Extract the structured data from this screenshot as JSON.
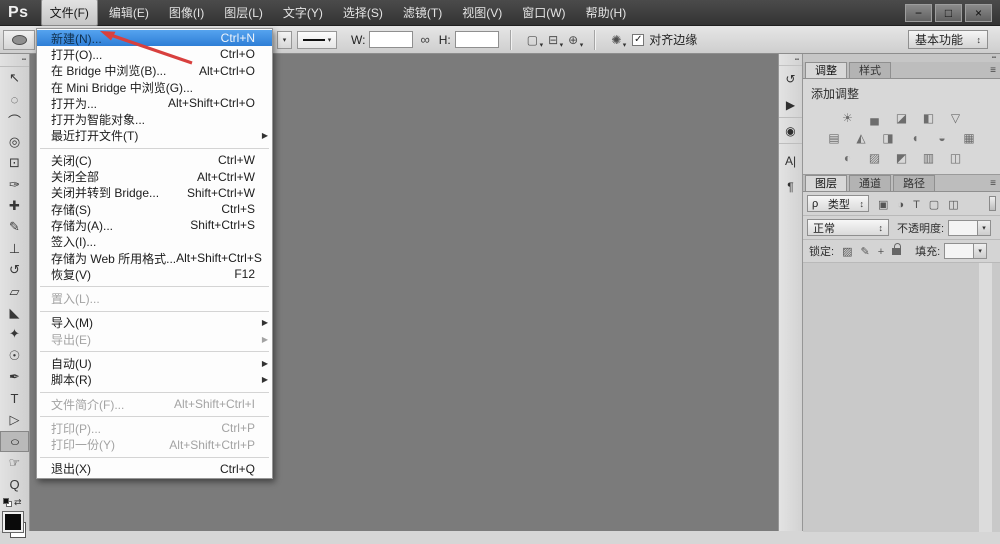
{
  "titlebar": {
    "logo": "Ps",
    "menus": [
      {
        "label": "文件(F)",
        "state": "pressed"
      },
      {
        "label": "编辑(E)"
      },
      {
        "label": "图像(I)"
      },
      {
        "label": "图层(L)"
      },
      {
        "label": "文字(Y)"
      },
      {
        "label": "选择(S)"
      },
      {
        "label": "滤镜(T)"
      },
      {
        "label": "视图(V)"
      },
      {
        "label": "窗口(W)"
      },
      {
        "label": "帮助(H)"
      }
    ],
    "window_buttons": {
      "minimize": "−",
      "maximize": "□",
      "close": "×"
    }
  },
  "file_menu": {
    "items": [
      {
        "label": "新建(N)...",
        "shortcut": "Ctrl+N",
        "state": "highlighted"
      },
      {
        "label": "打开(O)...",
        "shortcut": "Ctrl+O"
      },
      {
        "label": "在 Bridge 中浏览(B)...",
        "shortcut": "Alt+Ctrl+O"
      },
      {
        "label": "在 Mini Bridge 中浏览(G)...",
        "shortcut": ""
      },
      {
        "label": "打开为...",
        "shortcut": "Alt+Shift+Ctrl+O"
      },
      {
        "label": "打开为智能对象...",
        "shortcut": ""
      },
      {
        "label": "最近打开文件(T)",
        "shortcut": "",
        "arrow": "▶"
      },
      {
        "type": "sep"
      },
      {
        "label": "关闭(C)",
        "shortcut": "Ctrl+W"
      },
      {
        "label": "关闭全部",
        "shortcut": "Alt+Ctrl+W"
      },
      {
        "label": "关闭并转到 Bridge...",
        "shortcut": "Shift+Ctrl+W"
      },
      {
        "label": "存储(S)",
        "shortcut": "Ctrl+S"
      },
      {
        "label": "存储为(A)...",
        "shortcut": "Shift+Ctrl+S"
      },
      {
        "label": "签入(I)...",
        "shortcut": ""
      },
      {
        "label": "存储为 Web 所用格式...",
        "shortcut": "Alt+Shift+Ctrl+S"
      },
      {
        "label": "恢复(V)",
        "shortcut": "F12"
      },
      {
        "type": "sep"
      },
      {
        "label": "置入(L)...",
        "shortcut": "",
        "state": "disabled"
      },
      {
        "type": "sep"
      },
      {
        "label": "导入(M)",
        "shortcut": "",
        "arrow": "▶"
      },
      {
        "label": "导出(E)",
        "shortcut": "",
        "arrow": "▶",
        "state": "disabled"
      },
      {
        "type": "sep"
      },
      {
        "label": "自动(U)",
        "shortcut": "",
        "arrow": "▶"
      },
      {
        "label": "脚本(R)",
        "shortcut": "",
        "arrow": "▶"
      },
      {
        "type": "sep"
      },
      {
        "label": "文件简介(F)...",
        "shortcut": "Alt+Shift+Ctrl+I",
        "state": "disabled"
      },
      {
        "type": "sep"
      },
      {
        "label": "打印(P)...",
        "shortcut": "Ctrl+P",
        "state": "disabled"
      },
      {
        "label": "打印一份(Y)",
        "shortcut": "Alt+Shift+Ctrl+P",
        "state": "disabled"
      },
      {
        "type": "sep"
      },
      {
        "label": "退出(X)",
        "shortcut": "Ctrl+Q"
      }
    ]
  },
  "options_bar": {
    "w_label": "W:",
    "w_value": "",
    "h_label": "H:",
    "h_value": "",
    "link_glyph": "∞",
    "drop_glyph": "▾",
    "path_icons": [
      {
        "name": "path-operations-icon",
        "glyph": "▢"
      },
      {
        "name": "path-alignment-icon",
        "glyph": "⊟"
      },
      {
        "name": "path-arrangement-icon",
        "glyph": "⊕"
      }
    ],
    "gear_glyph": "✺",
    "check_glyph": "✓",
    "align_edges_label": "对齐边缘",
    "workspace_label": "基本功能",
    "workspace_arrows": "↕"
  },
  "toolbar": {
    "grip_glyph": "▪▪",
    "tools": [
      {
        "name": "move",
        "glyph": "↖"
      },
      {
        "name": "marquee",
        "glyph": "◌"
      },
      {
        "name": "lasso",
        "glyph": "⌒"
      },
      {
        "name": "quick-selection",
        "glyph": "◎"
      },
      {
        "name": "crop",
        "glyph": "⊡"
      },
      {
        "name": "eyedropper",
        "glyph": "✑"
      },
      {
        "name": "spot-healing",
        "glyph": "✚"
      },
      {
        "name": "brush",
        "glyph": "✎"
      },
      {
        "name": "clone-stamp",
        "glyph": "⊥"
      },
      {
        "name": "history-brush",
        "glyph": "↺"
      },
      {
        "name": "eraser",
        "glyph": "▱"
      },
      {
        "name": "paint-bucket",
        "glyph": "◣"
      },
      {
        "name": "blur",
        "glyph": "✦"
      },
      {
        "name": "dodge",
        "glyph": "☉"
      },
      {
        "name": "pen",
        "glyph": "✒"
      },
      {
        "name": "type",
        "glyph": "T"
      },
      {
        "name": "path-selection",
        "glyph": "▷"
      },
      {
        "name": "ellipse-shape",
        "glyph": "○",
        "state": "selected"
      },
      {
        "name": "hand",
        "glyph": "☞"
      },
      {
        "name": "zoom",
        "glyph": "Q"
      }
    ],
    "swap_glyph": "⇄"
  },
  "dock": {
    "grip_glyph": "▪▪",
    "icons": [
      {
        "name": "history-panel-icon",
        "glyph": "↺"
      },
      {
        "name": "actions-panel-icon",
        "glyph": "▶"
      },
      {
        "name": "animation-panel-icon",
        "glyph": "◉"
      },
      {
        "name": "character-panel-icon",
        "glyph": "A|"
      },
      {
        "name": "paragraph-panel-icon",
        "glyph": "¶"
      }
    ]
  },
  "panels": {
    "collapse_glyph": "▪▪",
    "panel_menu_glyph": "≡",
    "adjustments": {
      "tabs": [
        {
          "label": "调整",
          "state": "active"
        },
        {
          "label": "样式"
        }
      ],
      "add_label": "添加调整",
      "row1": [
        {
          "name": "brightness-contrast-icon",
          "glyph": "☀"
        },
        {
          "name": "levels-icon",
          "glyph": "▄"
        },
        {
          "name": "curves-icon",
          "glyph": "◪"
        },
        {
          "name": "exposure-icon",
          "glyph": "◧"
        },
        {
          "name": "vibrance-icon",
          "glyph": "▽"
        }
      ],
      "row2": [
        {
          "name": "hue-saturation-icon",
          "glyph": "▤"
        },
        {
          "name": "color-balance-icon",
          "glyph": "◭"
        },
        {
          "name": "black-white-icon",
          "glyph": "◨"
        },
        {
          "name": "photo-filter-icon",
          "glyph": "◖"
        },
        {
          "name": "channel-mixer-icon",
          "glyph": "◒"
        },
        {
          "name": "color-lookup-icon",
          "glyph": "▦"
        }
      ],
      "row3": [
        {
          "name": "invert-icon",
          "glyph": "◐"
        },
        {
          "name": "posterize-icon",
          "glyph": "▨"
        },
        {
          "name": "threshold-icon",
          "glyph": "◩"
        },
        {
          "name": "gradient-map-icon",
          "glyph": "▥"
        },
        {
          "name": "selective-color-icon",
          "glyph": "◫"
        }
      ]
    },
    "layers": {
      "tabs": [
        {
          "label": "图层",
          "state": "active"
        },
        {
          "label": "通道"
        },
        {
          "label": "路径"
        }
      ],
      "search_glyph": "ρ",
      "filter_type_label": "类型",
      "filter_arrows": "↕",
      "filter_icons": [
        {
          "name": "filter-pixel-layers-icon",
          "glyph": "▣"
        },
        {
          "name": "filter-adjustment-layers-icon",
          "glyph": "◑"
        },
        {
          "name": "filter-type-layers-icon",
          "glyph": "T"
        },
        {
          "name": "filter-shape-layers-icon",
          "glyph": "▢"
        },
        {
          "name": "filter-smart-objects-icon",
          "glyph": "◫"
        }
      ],
      "blend_mode": "正常",
      "blend_arrows": "↕",
      "opacity_label": "不透明度:",
      "opacity_value": "",
      "lock_label": "锁定:",
      "lock_icons": [
        {
          "name": "lock-transparency-icon",
          "glyph": "▨"
        },
        {
          "name": "lock-pixels-icon",
          "glyph": "✎"
        },
        {
          "name": "lock-position-icon",
          "glyph": "+"
        }
      ],
      "fill_label": "填充:",
      "fill_value": ""
    }
  },
  "annotation": {
    "arrow_color": "#d8403e"
  },
  "colors": {
    "canvas": "#7b7b7b",
    "titlebar": "#3f3f3f",
    "menu_highlight": "#3c8ede"
  }
}
